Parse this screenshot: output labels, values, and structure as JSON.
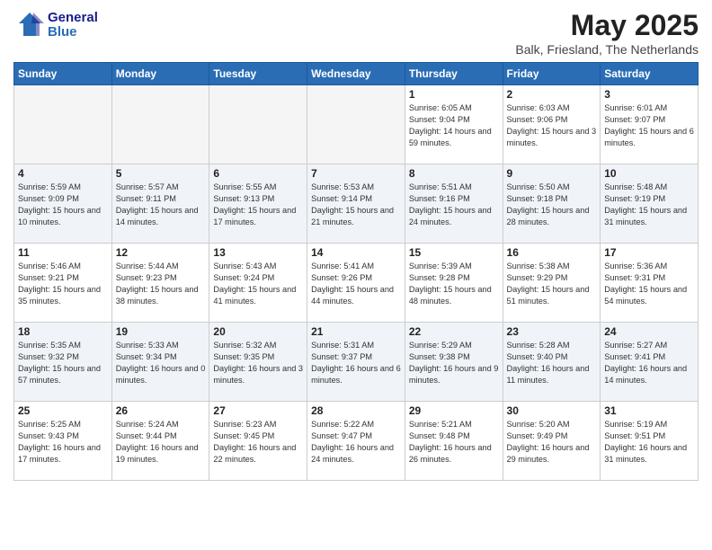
{
  "logo": {
    "line1": "General",
    "line2": "Blue"
  },
  "title": "May 2025",
  "location": "Balk, Friesland, The Netherlands",
  "days_of_week": [
    "Sunday",
    "Monday",
    "Tuesday",
    "Wednesday",
    "Thursday",
    "Friday",
    "Saturday"
  ],
  "weeks": [
    [
      {
        "day": "",
        "info": ""
      },
      {
        "day": "",
        "info": ""
      },
      {
        "day": "",
        "info": ""
      },
      {
        "day": "",
        "info": ""
      },
      {
        "day": "1",
        "info": "Sunrise: 6:05 AM\nSunset: 9:04 PM\nDaylight: 14 hours\nand 59 minutes."
      },
      {
        "day": "2",
        "info": "Sunrise: 6:03 AM\nSunset: 9:06 PM\nDaylight: 15 hours\nand 3 minutes."
      },
      {
        "day": "3",
        "info": "Sunrise: 6:01 AM\nSunset: 9:07 PM\nDaylight: 15 hours\nand 6 minutes."
      }
    ],
    [
      {
        "day": "4",
        "info": "Sunrise: 5:59 AM\nSunset: 9:09 PM\nDaylight: 15 hours\nand 10 minutes."
      },
      {
        "day": "5",
        "info": "Sunrise: 5:57 AM\nSunset: 9:11 PM\nDaylight: 15 hours\nand 14 minutes."
      },
      {
        "day": "6",
        "info": "Sunrise: 5:55 AM\nSunset: 9:13 PM\nDaylight: 15 hours\nand 17 minutes."
      },
      {
        "day": "7",
        "info": "Sunrise: 5:53 AM\nSunset: 9:14 PM\nDaylight: 15 hours\nand 21 minutes."
      },
      {
        "day": "8",
        "info": "Sunrise: 5:51 AM\nSunset: 9:16 PM\nDaylight: 15 hours\nand 24 minutes."
      },
      {
        "day": "9",
        "info": "Sunrise: 5:50 AM\nSunset: 9:18 PM\nDaylight: 15 hours\nand 28 minutes."
      },
      {
        "day": "10",
        "info": "Sunrise: 5:48 AM\nSunset: 9:19 PM\nDaylight: 15 hours\nand 31 minutes."
      }
    ],
    [
      {
        "day": "11",
        "info": "Sunrise: 5:46 AM\nSunset: 9:21 PM\nDaylight: 15 hours\nand 35 minutes."
      },
      {
        "day": "12",
        "info": "Sunrise: 5:44 AM\nSunset: 9:23 PM\nDaylight: 15 hours\nand 38 minutes."
      },
      {
        "day": "13",
        "info": "Sunrise: 5:43 AM\nSunset: 9:24 PM\nDaylight: 15 hours\nand 41 minutes."
      },
      {
        "day": "14",
        "info": "Sunrise: 5:41 AM\nSunset: 9:26 PM\nDaylight: 15 hours\nand 44 minutes."
      },
      {
        "day": "15",
        "info": "Sunrise: 5:39 AM\nSunset: 9:28 PM\nDaylight: 15 hours\nand 48 minutes."
      },
      {
        "day": "16",
        "info": "Sunrise: 5:38 AM\nSunset: 9:29 PM\nDaylight: 15 hours\nand 51 minutes."
      },
      {
        "day": "17",
        "info": "Sunrise: 5:36 AM\nSunset: 9:31 PM\nDaylight: 15 hours\nand 54 minutes."
      }
    ],
    [
      {
        "day": "18",
        "info": "Sunrise: 5:35 AM\nSunset: 9:32 PM\nDaylight: 15 hours\nand 57 minutes."
      },
      {
        "day": "19",
        "info": "Sunrise: 5:33 AM\nSunset: 9:34 PM\nDaylight: 16 hours\nand 0 minutes."
      },
      {
        "day": "20",
        "info": "Sunrise: 5:32 AM\nSunset: 9:35 PM\nDaylight: 16 hours\nand 3 minutes."
      },
      {
        "day": "21",
        "info": "Sunrise: 5:31 AM\nSunset: 9:37 PM\nDaylight: 16 hours\nand 6 minutes."
      },
      {
        "day": "22",
        "info": "Sunrise: 5:29 AM\nSunset: 9:38 PM\nDaylight: 16 hours\nand 9 minutes."
      },
      {
        "day": "23",
        "info": "Sunrise: 5:28 AM\nSunset: 9:40 PM\nDaylight: 16 hours\nand 11 minutes."
      },
      {
        "day": "24",
        "info": "Sunrise: 5:27 AM\nSunset: 9:41 PM\nDaylight: 16 hours\nand 14 minutes."
      }
    ],
    [
      {
        "day": "25",
        "info": "Sunrise: 5:25 AM\nSunset: 9:43 PM\nDaylight: 16 hours\nand 17 minutes."
      },
      {
        "day": "26",
        "info": "Sunrise: 5:24 AM\nSunset: 9:44 PM\nDaylight: 16 hours\nand 19 minutes."
      },
      {
        "day": "27",
        "info": "Sunrise: 5:23 AM\nSunset: 9:45 PM\nDaylight: 16 hours\nand 22 minutes."
      },
      {
        "day": "28",
        "info": "Sunrise: 5:22 AM\nSunset: 9:47 PM\nDaylight: 16 hours\nand 24 minutes."
      },
      {
        "day": "29",
        "info": "Sunrise: 5:21 AM\nSunset: 9:48 PM\nDaylight: 16 hours\nand 26 minutes."
      },
      {
        "day": "30",
        "info": "Sunrise: 5:20 AM\nSunset: 9:49 PM\nDaylight: 16 hours\nand 29 minutes."
      },
      {
        "day": "31",
        "info": "Sunrise: 5:19 AM\nSunset: 9:51 PM\nDaylight: 16 hours\nand 31 minutes."
      }
    ]
  ]
}
